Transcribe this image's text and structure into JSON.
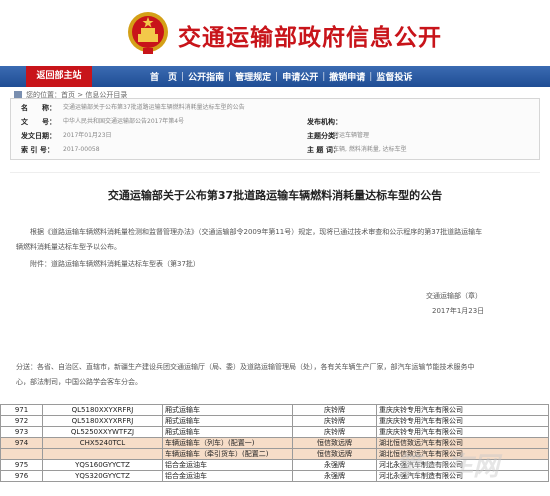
{
  "header": {
    "site_title": "交通运输部政府信息公开"
  },
  "nav": {
    "home": "返回部主站",
    "items": [
      "首　页",
      "公开指南",
      "管理规定",
      "申请公开",
      "撤销申请",
      "监督投诉"
    ]
  },
  "breadcrumb": "您的位置：首页 > 信息公开目录",
  "meta": {
    "name_label": "名　　称：",
    "name_value": "交通运输部关于公布第37批道路运输车辆燃料消耗量达标车型的公告",
    "doc_label": "文　　号：",
    "doc_value": "中华人民共和国交通运输部公告2017年第4号",
    "issuer_label": "发布机构：",
    "issuer_value": "",
    "date_label": "发文日期：",
    "date_value": "2017年01月23日",
    "subject_label": "主题分类：",
    "subject_value": "营运车辆管理",
    "index_label": "索 引 号：",
    "index_value": "2017-00058",
    "keyword_label": "主 题 词：",
    "keyword_value": "车辆, 燃料消耗量, 达标车型"
  },
  "doc": {
    "title": "交通运输部关于公布第37批道路运输车辆燃料消耗量达标车型的公告",
    "para1a": "根据《道路运输车辆燃料消耗量检测和监督管理办法》（交通运输部令2009年第11号）规定，现将已通过技术审查和公示程序的第37批道路运输车",
    "para1b": "辆燃料消耗量达标车型予以公布。",
    "attachment": "附件：道路运输车辆燃料消耗量达标车型表（第37批）",
    "sign_org": "交通运输部（章）",
    "sign_date": "2017年1月23日",
    "cc_a": "分送：各省、自治区、直辖市，新疆生产建设兵团交通运输厅（局、委）及道路运输管理局（处），各有关车辆生产厂家，部汽车运输节能技术服务中",
    "cc_b": "心，部法制司，中国公路学会客车分会。"
  },
  "table": {
    "rows": [
      {
        "no": "971",
        "model": "QL5180XXYXRFRJ",
        "type": "厢式运输车",
        "brand": "庆铃牌",
        "maker": "重庆庆铃专用汽车有限公司",
        "hl": false
      },
      {
        "no": "972",
        "model": "QL5180XXYXRFRJ",
        "type": "厢式运输车",
        "brand": "庆铃牌",
        "maker": "重庆庆铃专用汽车有限公司",
        "hl": false
      },
      {
        "no": "973",
        "model": "QL5250XXYWTFZJ",
        "type": "厢式运输车",
        "brand": "庆铃牌",
        "maker": "重庆庆铃专用汽车有限公司",
        "hl": false
      },
      {
        "no": "974",
        "model": "CHX5240TCL",
        "type": "车辆运输车（列车）(配置一)",
        "brand": "恒信致远牌",
        "maker": "湖北恒信致远汽车有限公司",
        "hl": true
      },
      {
        "no": "",
        "model": "",
        "type": "车辆运输车（牵引货车）(配置二)",
        "brand": "恒信致远牌",
        "maker": "湖北恒信致远汽车有限公司",
        "hl": true
      },
      {
        "no": "975",
        "model": "YQS160GYYCTZ",
        "type": "铝合金运油车",
        "brand": "永强牌",
        "maker": "河北永强汽车制造有限公司",
        "hl": false
      },
      {
        "no": "976",
        "model": "YQS320GYYCTZ",
        "type": "铝合金运油车",
        "brand": "永强牌",
        "maker": "河北永强汽车制造有限公司",
        "hl": false
      }
    ]
  },
  "colors": {
    "title_red": "#c8141a",
    "nav_blue": "#2a5aa3",
    "highlight": "#f6ddc8"
  }
}
